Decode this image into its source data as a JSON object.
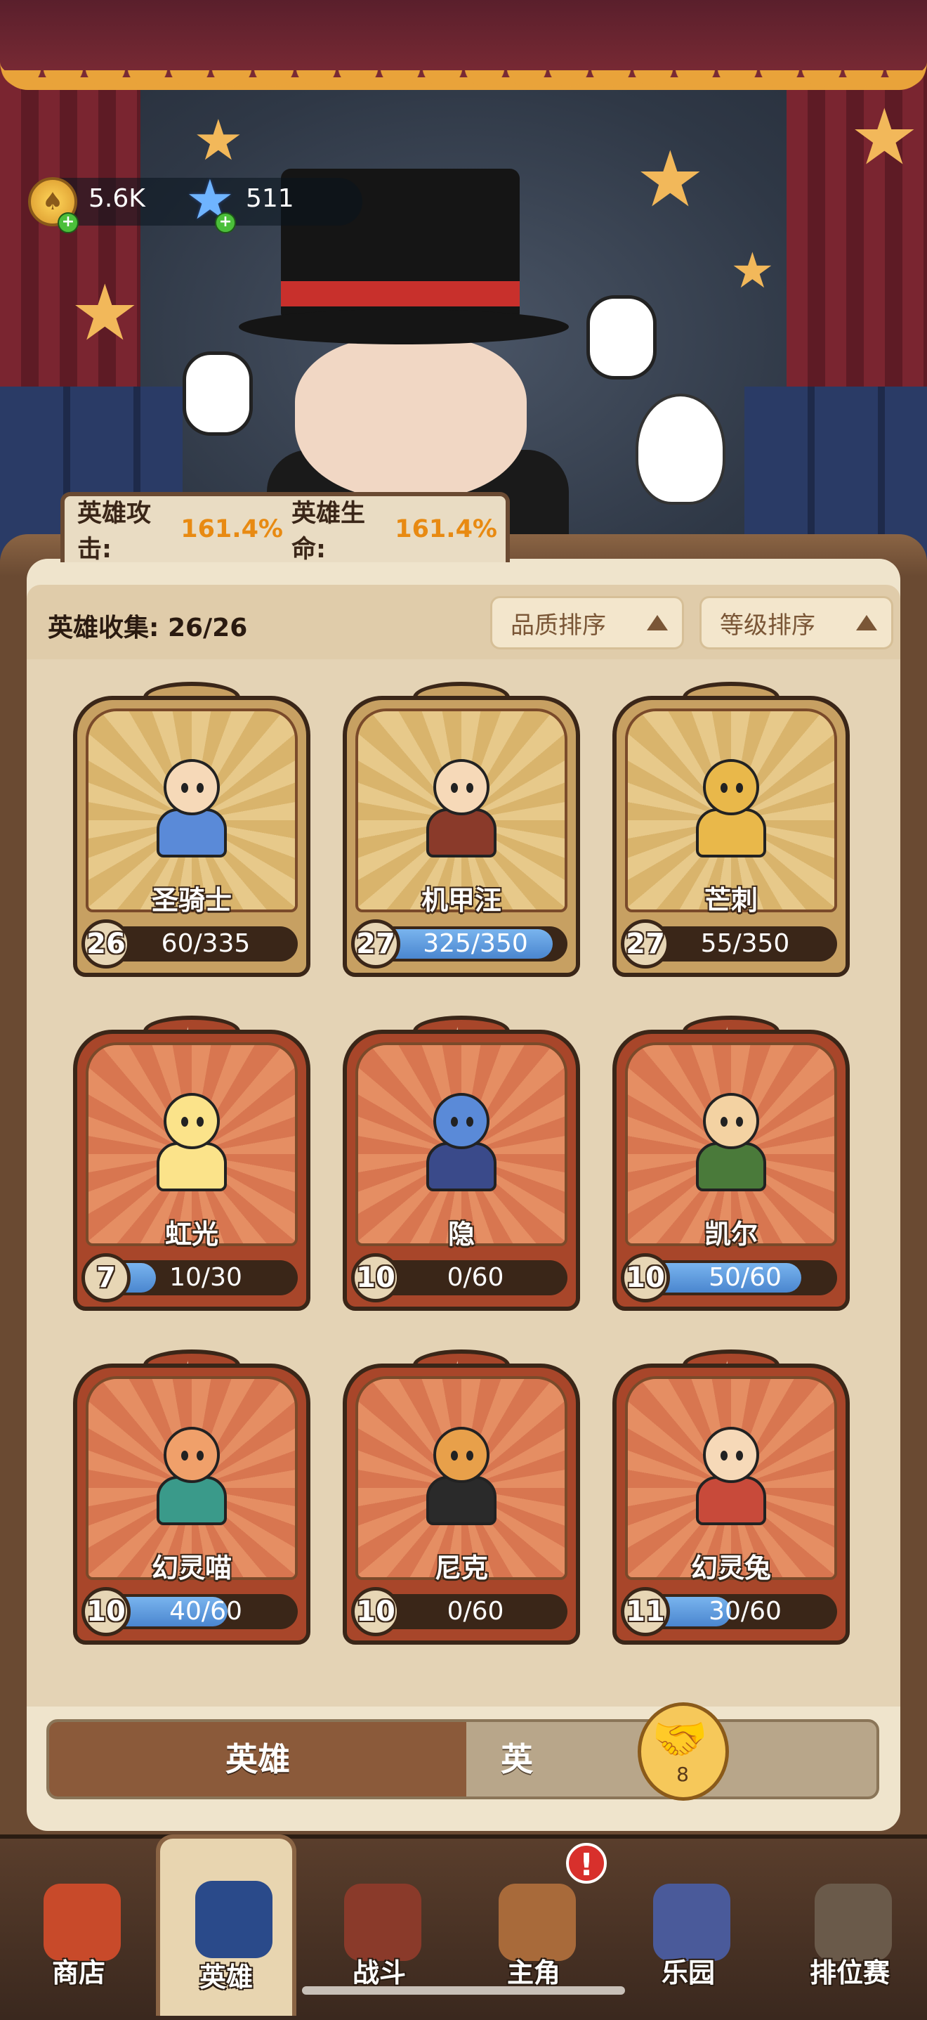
{
  "resources": {
    "coins": "5.6K",
    "gems": "511"
  },
  "bonus": {
    "attack_label": "英雄攻击:",
    "attack_value": "161.4%",
    "hp_label": "英雄生命:",
    "hp_value": "161.4%"
  },
  "collection": {
    "label": "英雄收集: ",
    "value": "26/26"
  },
  "sort": {
    "quality": "品质排序",
    "level": "等级排序"
  },
  "heroes": [
    {
      "name": "圣骑士",
      "level": "26",
      "progress": "60/335",
      "fill": 0.18,
      "rarity": "gold"
    },
    {
      "name": "机甲汪",
      "level": "27",
      "progress": "325/350",
      "fill": 0.93,
      "rarity": "gold"
    },
    {
      "name": "芒刺",
      "level": "27",
      "progress": "55/350",
      "fill": 0.16,
      "rarity": "gold"
    },
    {
      "name": "虹光",
      "level": "7",
      "progress": "10/30",
      "fill": 0.33,
      "rarity": "red"
    },
    {
      "name": "隐",
      "level": "10",
      "progress": "0/60",
      "fill": 0.0,
      "rarity": "red"
    },
    {
      "name": "凯尔",
      "level": "10",
      "progress": "50/60",
      "fill": 0.83,
      "rarity": "red"
    },
    {
      "name": "幻灵喵",
      "level": "10",
      "progress": "40/60",
      "fill": 0.67,
      "rarity": "red"
    },
    {
      "name": "尼克",
      "level": "10",
      "progress": "0/60",
      "fill": 0.0,
      "rarity": "red"
    },
    {
      "name": "幻灵兔",
      "level": "11",
      "progress": "30/60",
      "fill": 0.5,
      "rarity": "red"
    }
  ],
  "tabs": {
    "heroes": "英雄",
    "other": "英签",
    "badge_count": "8"
  },
  "nav": [
    {
      "label": "商店",
      "icon": "shop-tent-icon",
      "color": "#c84a2a"
    },
    {
      "label": "英雄",
      "icon": "hero-cards-icon",
      "color": "#2a4a8a"
    },
    {
      "label": "战斗",
      "icon": "crossbow-icon",
      "color": "#8a3a2a"
    },
    {
      "label": "主角",
      "icon": "owl-icon",
      "color": "#a86a3a"
    },
    {
      "label": "乐园",
      "icon": "castle-icon",
      "color": "#4a5a9a"
    },
    {
      "label": "排位赛",
      "icon": "lock-icon",
      "color": "#6a5a4a"
    }
  ]
}
